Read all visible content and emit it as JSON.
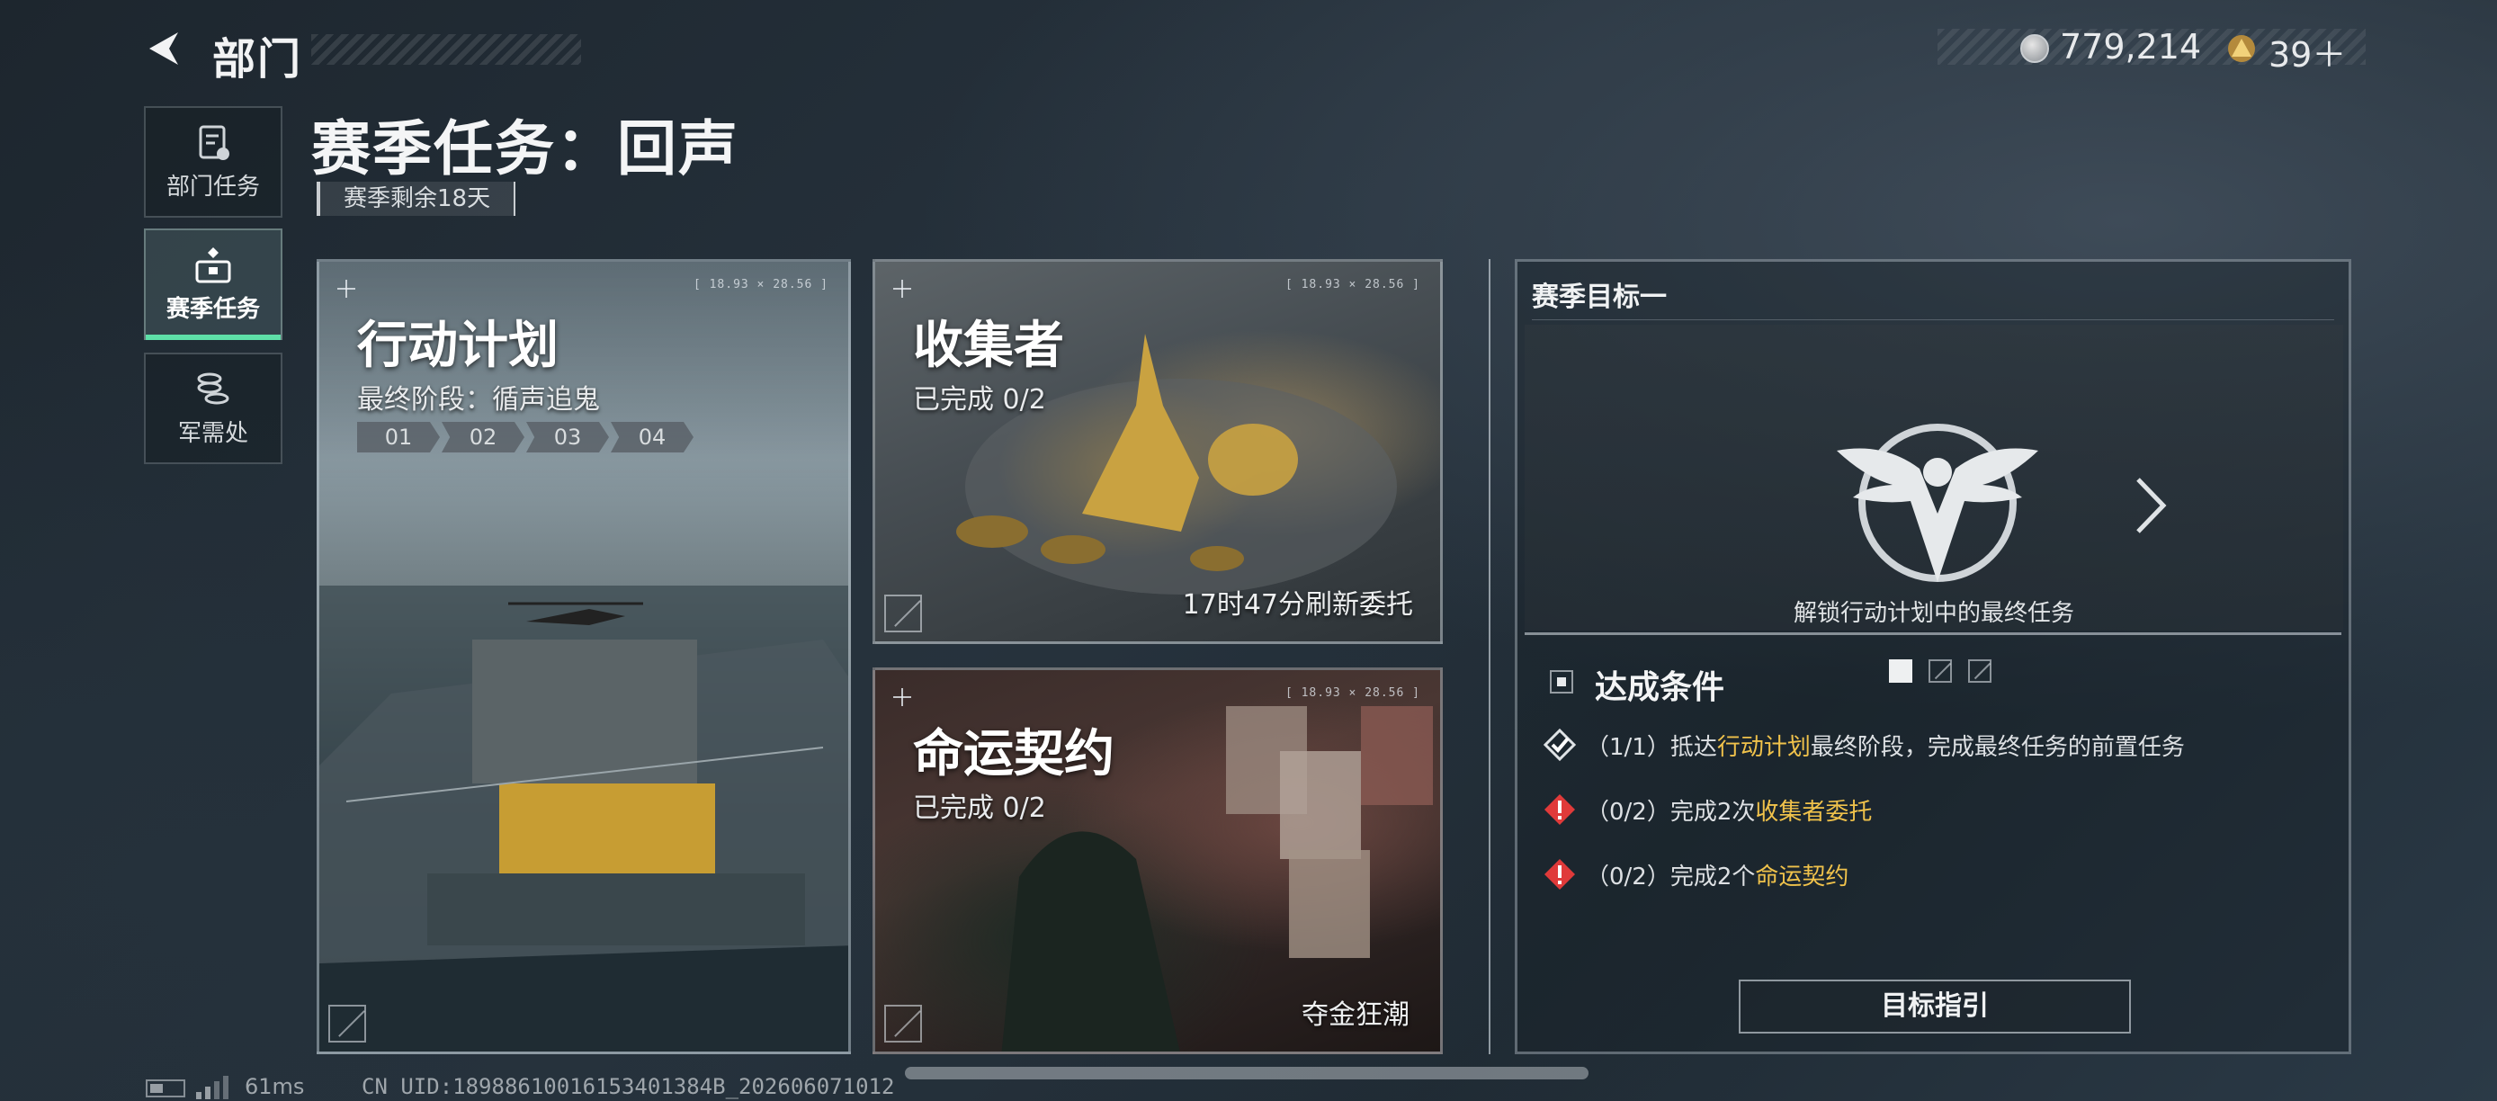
{
  "header": {
    "title": "部门",
    "currency": {
      "coin_value": "779,214",
      "gem_value": "39＋"
    }
  },
  "sidebar": {
    "items": [
      {
        "label": "部门任务",
        "icon": "document-icon",
        "active": false
      },
      {
        "label": "赛季任务",
        "icon": "briefcase-icon",
        "active": true
      },
      {
        "label": "军需处",
        "icon": "coins-icon",
        "active": false
      }
    ]
  },
  "page": {
    "title": "赛季任务：回声",
    "season_remaining": "赛季剩余18天"
  },
  "cards": {
    "plan": {
      "title": "行动计划",
      "subtitle": "最终阶段：循声追鬼",
      "stages": [
        "01",
        "02",
        "03",
        "04"
      ],
      "coords": "[ 18.93 × 28.56 ]"
    },
    "collector": {
      "title": "收集者",
      "progress": "已完成 0/2",
      "refresh": "17时47分刷新委托",
      "coords": "[ 18.93 × 28.56 ]"
    },
    "fate": {
      "title": "命运契约",
      "progress": "已完成 0/2",
      "footer": "夺金狂潮",
      "coords": "[ 18.93 × 28.56 ]"
    }
  },
  "goal": {
    "header": "赛季目标一",
    "description": "解锁行动计划中的最终任务",
    "conditions_title": "达成条件",
    "conditions": [
      {
        "prefix": "（1/1）抵达",
        "highlight": "行动计划",
        "suffix": "最终阶段，完成最终任务的前置任务",
        "status": "done"
      },
      {
        "prefix": "（0/2）完成2次",
        "highlight": "收集者委托",
        "suffix": "",
        "status": "incomplete"
      },
      {
        "prefix": "（0/2）完成2个",
        "highlight": "命运契约",
        "suffix": "",
        "status": "incomplete"
      }
    ],
    "button_label": "目标指引"
  },
  "status_bar": {
    "ping": "61ms",
    "uid": "CN UID:18988610016153401384B_202606071012"
  },
  "colors": {
    "accent_green": "#5ee0a8",
    "highlight_gold": "#f0c24b",
    "warning_red": "#e03a3a"
  }
}
